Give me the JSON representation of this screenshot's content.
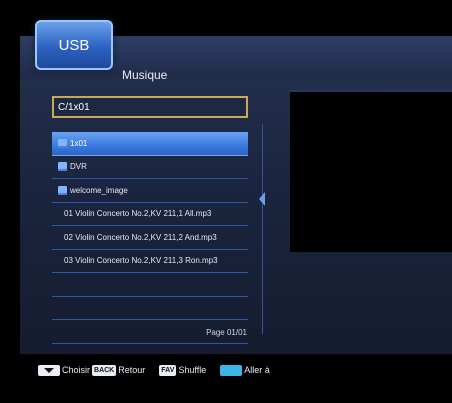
{
  "header": {
    "tab_label": "USB",
    "title": "Musique"
  },
  "path": "C/1x01",
  "files": [
    {
      "name": "1x01",
      "type": "folder",
      "selected": true
    },
    {
      "name": "DVR",
      "type": "folder"
    },
    {
      "name": "welcome_image",
      "type": "folder"
    },
    {
      "name": "01 Violin Concerto No.2,KV 211,1 All.mp3",
      "type": "file"
    },
    {
      "name": "02 Violin Concerto No.2,KV 211,2 And.mp3",
      "type": "file"
    },
    {
      "name": "03 Violin Concerto No.2,KV 211,3 Ron.mp3",
      "type": "file"
    },
    {
      "name": "",
      "type": "empty"
    },
    {
      "name": "",
      "type": "empty"
    },
    {
      "name": "",
      "type": "empty"
    }
  ],
  "page": "Page  01/01",
  "help": {
    "choose": "Choisir",
    "back_key": "BACK",
    "back": "Retour",
    "fav_key": "FAV",
    "shuffle": "Shuffle",
    "goto": "Aller à"
  },
  "icons": [
    "folder-icon",
    "nav-key-icon",
    "blue-key-icon"
  ],
  "colors": {
    "selected": "#3b79dd",
    "path_border": "#c9a85a",
    "blue_key": "#3db5e8"
  }
}
